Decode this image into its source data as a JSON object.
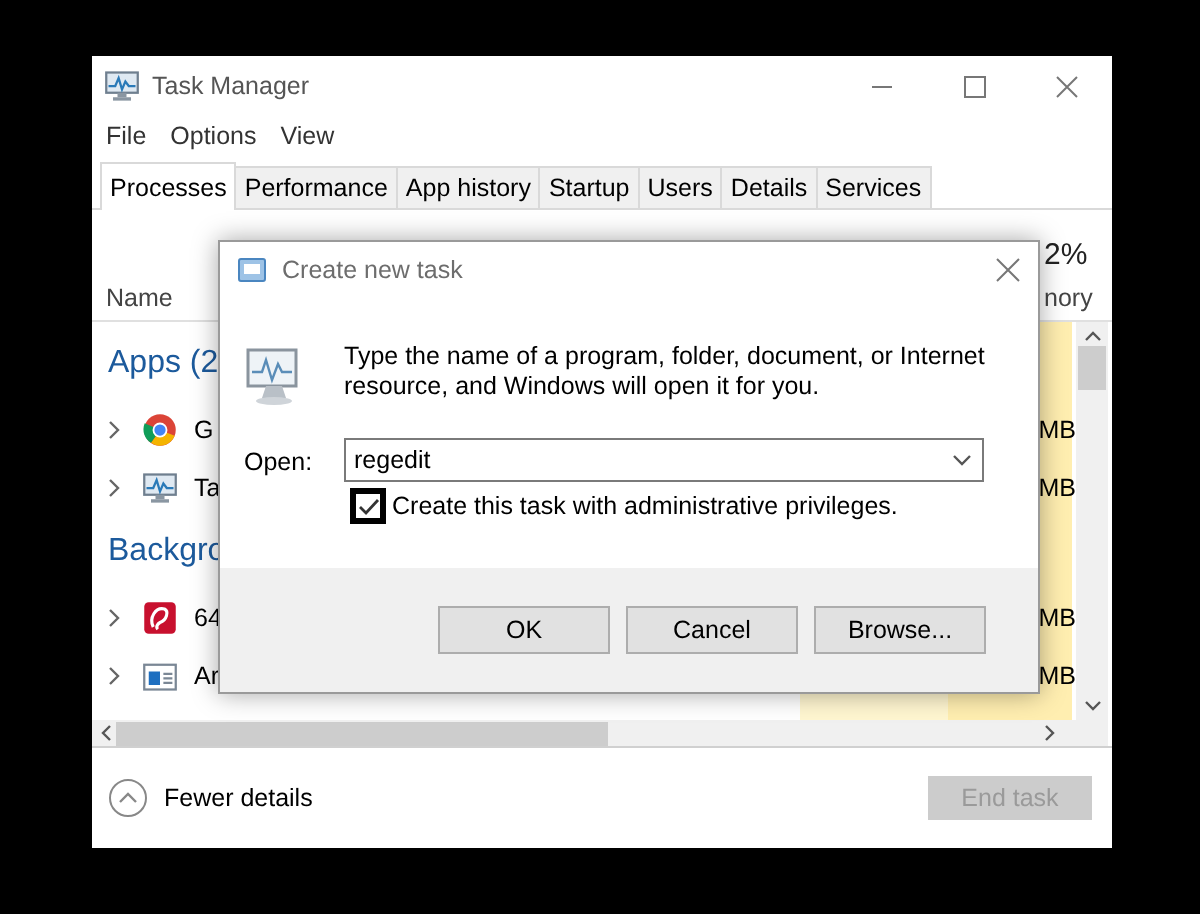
{
  "window": {
    "title": "Task Manager"
  },
  "menu": [
    "File",
    "Options",
    "View"
  ],
  "tabs": [
    {
      "label": "Processes",
      "selected": true
    },
    {
      "label": "Performance",
      "selected": false
    },
    {
      "label": "App history",
      "selected": false
    },
    {
      "label": "Startup",
      "selected": false
    },
    {
      "label": "Users",
      "selected": false
    },
    {
      "label": "Details",
      "selected": false
    },
    {
      "label": "Services",
      "selected": false
    }
  ],
  "header": {
    "name_column": "Name",
    "column_2": {
      "usage": "2%",
      "label": "nory"
    }
  },
  "groups": [
    {
      "title": "Apps (2",
      "rows": [
        {
          "kind": "browser",
          "name": "G",
          "memory": "MB"
        },
        {
          "kind": "monitor",
          "name": "Ta",
          "memory": "MB"
        }
      ]
    },
    {
      "title": "Backgro",
      "rows": [
        {
          "kind": "red-app",
          "name": "64",
          "memory": "MB"
        },
        {
          "kind": "window",
          "name": "Ar",
          "memory": "MB"
        }
      ]
    }
  ],
  "footer": {
    "details_toggle": "Fewer details",
    "end_task": {
      "label": "End task",
      "disabled": true
    }
  },
  "dialog": {
    "title": "Create new task",
    "message": "Type the name of a program, folder, document, or Internet resource, and Windows will open it for you.",
    "open_label": "Open:",
    "command": {
      "value": "regedit"
    },
    "admin_checkbox": {
      "label": "Create this task with administrative privileges.",
      "checked": true
    },
    "buttons": [
      "OK",
      "Cancel",
      "Browse..."
    ]
  }
}
